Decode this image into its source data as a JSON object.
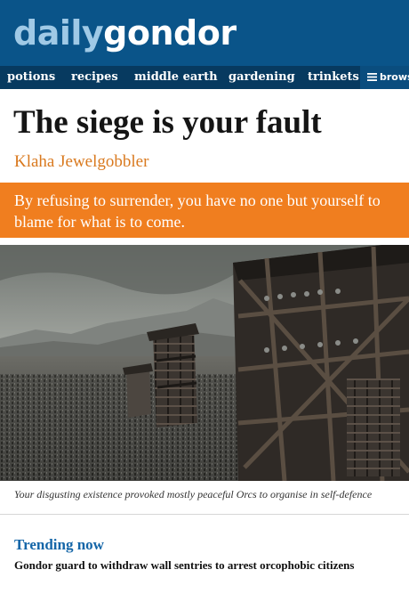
{
  "site": {
    "logo_light": "daily",
    "logo_bold": "gondor"
  },
  "nav": {
    "items": [
      {
        "label": "potions"
      },
      {
        "label": "recipes"
      },
      {
        "label": "middle earth"
      },
      {
        "label": "gardening"
      },
      {
        "label": "trinkets"
      }
    ],
    "browse_label": "browse",
    "browse_icon": "menu-icon"
  },
  "article": {
    "headline": "The siege is your fault",
    "author": "Klaha Jewelgobbler",
    "standfirst": "By refusing to surrender, you have no one but yourself to blame for what is to come.",
    "image_caption": "Your disgusting existence provoked mostly peaceful Orcs to organise in self-defence"
  },
  "trending": {
    "title": "Trending now",
    "items": [
      {
        "headline": "Gondor guard to withdraw wall sentries to arrest orcophobic citizens"
      }
    ]
  },
  "colors": {
    "masthead": "#0a5489",
    "navbar": "#073a60",
    "accent_orange": "#f07e1f",
    "byline": "#d9791e",
    "trending": "#1566a8"
  }
}
